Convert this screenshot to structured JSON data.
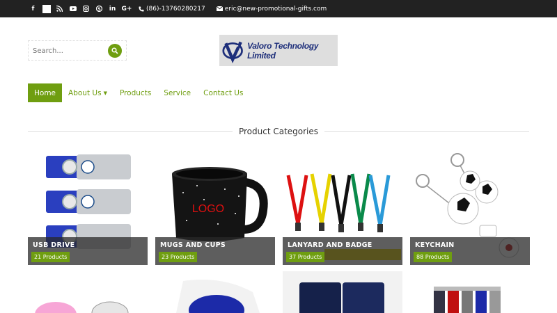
{
  "topbar": {
    "social_icons": [
      "facebook-icon",
      "square-icon",
      "rss-icon",
      "youtube-icon",
      "instagram-icon",
      "skype-icon",
      "linkedin-icon",
      "google-plus-icon"
    ],
    "phone": "(86)-13760280217",
    "email": "eric@new-promotional-gifts.com"
  },
  "search": {
    "placeholder": "Search..."
  },
  "logo": {
    "text": "Valoro Technology Limited"
  },
  "nav": {
    "items": [
      {
        "label": "Home",
        "active": true
      },
      {
        "label": "About Us",
        "has_dropdown": true
      },
      {
        "label": "Products"
      },
      {
        "label": "Service"
      },
      {
        "label": "Contact Us"
      }
    ]
  },
  "categories": {
    "title": "Product Categories",
    "items": [
      {
        "name": "USB DRIVE",
        "count": "21 Products"
      },
      {
        "name": "MUGS AND CUPS",
        "count": "23 Products",
        "image_text": "LOGO"
      },
      {
        "name": "LANYARD AND BADGE",
        "count": "37 Products"
      },
      {
        "name": "KEYCHAIN",
        "count": "88 Products"
      }
    ]
  },
  "colors": {
    "accent": "#6f9e10",
    "topbar": "#222222",
    "logo_blue": "#1d2e7a"
  }
}
